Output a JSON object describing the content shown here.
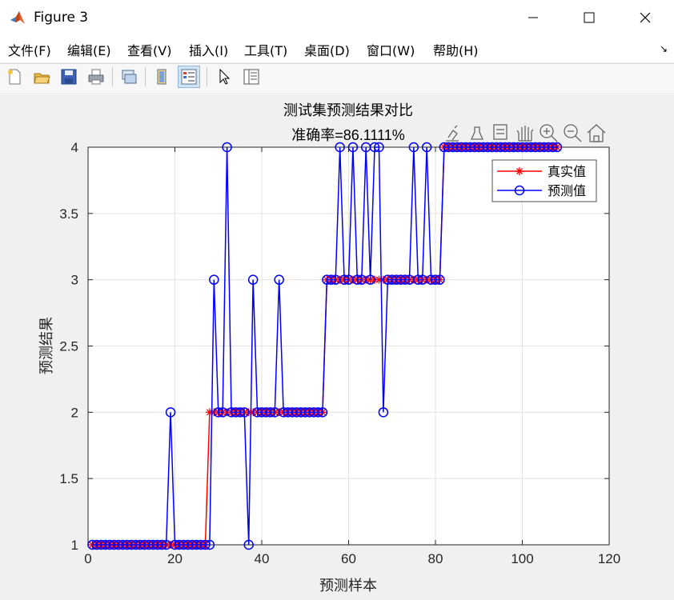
{
  "window": {
    "title": "Figure 3",
    "controls": [
      "minimize",
      "maximize",
      "close"
    ]
  },
  "menu": {
    "items": [
      "文件(F)",
      "编辑(E)",
      "查看(V)",
      "插入(I)",
      "工具(T)",
      "桌面(D)",
      "窗口(W)",
      "帮助(H)"
    ]
  },
  "toolbar": {
    "buttons": [
      "new-figure-icon",
      "open-file-icon",
      "save-icon",
      "print-icon",
      "link-plot-icon",
      "hide-plot-tools-icon",
      "show-plot-tools-icon",
      "edit-plot-arrow-icon",
      "property-inspector-icon"
    ]
  },
  "axes_toolbar": {
    "buttons": [
      "brush-export-icon",
      "data-brush-icon",
      "data-tips-icon",
      "pan-hand-icon",
      "zoom-in-icon",
      "zoom-out-icon",
      "home-restore-icon"
    ]
  },
  "chart_data": {
    "type": "line",
    "title": "测试集预测结果对比",
    "subtitle": "准确率=86.1111%",
    "xlabel": "预测样本",
    "ylabel": "预测结果",
    "xlim": [
      0,
      120
    ],
    "ylim": [
      1,
      4
    ],
    "xticks": [
      "0",
      "20",
      "40",
      "60",
      "80",
      "100",
      "120"
    ],
    "yticks": [
      "1",
      "1.5",
      "2",
      "2.5",
      "3",
      "3.5",
      "4"
    ],
    "grid": true,
    "legend_position": "top-right",
    "series": [
      {
        "name": "真实值",
        "color": "#ff0000",
        "marker": "star",
        "values": [
          1,
          1,
          1,
          1,
          1,
          1,
          1,
          1,
          1,
          1,
          1,
          1,
          1,
          1,
          1,
          1,
          1,
          1,
          1,
          1,
          1,
          1,
          1,
          1,
          1,
          1,
          1,
          2,
          2,
          2,
          2,
          2,
          2,
          2,
          2,
          2,
          2,
          2,
          2,
          2,
          2,
          2,
          2,
          2,
          2,
          2,
          2,
          2,
          2,
          2,
          2,
          2,
          2,
          2,
          3,
          3,
          3,
          3,
          3,
          3,
          3,
          3,
          3,
          3,
          3,
          3,
          3,
          3,
          3,
          3,
          3,
          3,
          3,
          3,
          3,
          3,
          3,
          3,
          3,
          3,
          3,
          4,
          4,
          4,
          4,
          4,
          4,
          4,
          4,
          4,
          4,
          4,
          4,
          4,
          4,
          4,
          4,
          4,
          4,
          4,
          4,
          4,
          4,
          4,
          4,
          4,
          4,
          4
        ]
      },
      {
        "name": "预测值",
        "color": "#0000ff",
        "marker": "circle",
        "values": [
          1,
          1,
          1,
          1,
          1,
          1,
          1,
          1,
          1,
          1,
          1,
          1,
          1,
          1,
          1,
          1,
          1,
          1,
          2,
          1,
          1,
          1,
          1,
          1,
          1,
          1,
          1,
          1,
          3,
          2,
          2,
          4,
          2,
          2,
          2,
          2,
          1,
          3,
          2,
          2,
          2,
          2,
          2,
          3,
          2,
          2,
          2,
          2,
          2,
          2,
          2,
          2,
          2,
          2,
          3,
          3,
          3,
          4,
          3,
          3,
          4,
          3,
          3,
          4,
          3,
          4,
          4,
          2,
          3,
          3,
          3,
          3,
          3,
          3,
          4,
          3,
          3,
          4,
          3,
          3,
          3,
          4,
          4,
          4,
          4,
          4,
          4,
          4,
          4,
          4,
          4,
          4,
          4,
          4,
          4,
          4,
          4,
          4,
          4,
          4,
          4,
          4,
          4,
          4,
          4,
          4,
          4,
          4
        ]
      }
    ]
  }
}
